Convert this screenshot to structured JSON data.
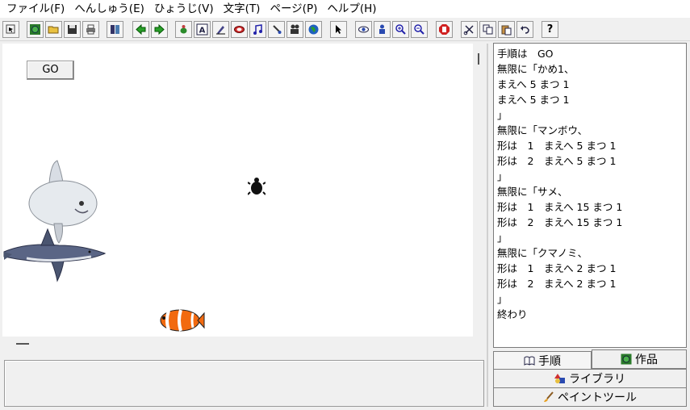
{
  "menu": [
    "ファイル(F)",
    "へんしゅう(E)",
    "ひょうじ(V)",
    "文字(T)",
    "ページ(P)",
    "ヘルプ(H)"
  ],
  "toolbar_icons": [
    "pointer-icon",
    "globe-icon",
    "open-folder-icon",
    "save-icon",
    "print-icon",
    "page-layout-icon",
    "arrow-left-icon",
    "arrow-right-icon",
    "turtle-icon",
    "text-icon",
    "pen-icon",
    "stamp-icon",
    "music-icon",
    "paint-brush-icon",
    "camera-icon",
    "world-icon",
    "select-arrow-icon",
    "eye-icon",
    "person-icon",
    "zoom-in-icon",
    "zoom-out-icon",
    "stop-icon",
    "cut-icon",
    "copy-icon",
    "paste-icon",
    "undo-icon",
    "help-icon"
  ],
  "stage": {
    "go_label": "GO"
  },
  "code": [
    "手順は　GO",
    "無限に「かめ1、",
    "まえへ 5 まつ 1",
    "まえへ 5 まつ 1",
    "」",
    "無限に「マンボウ、",
    "形は　1　まえへ 5 まつ 1",
    "形は　2　まえへ 5 まつ 1",
    "」",
    "無限に「サメ、",
    "形は　1　まえへ 15 まつ 1",
    "形は　2　まえへ 15 まつ 1",
    "」",
    "無限に「クマノミ、",
    "形は　1　まえへ 2 まつ 1",
    "形は　2　まえへ 2 まつ 1",
    "」",
    "終わり"
  ],
  "tabs": {
    "procedure": "手順",
    "works": "作品",
    "library": "ライブラリ",
    "paint_tool": "ペイントツール"
  },
  "colors": {
    "canvas_bg": "#ffffff",
    "window_bg": "#f0f0f0",
    "clownfish": "#f26a10",
    "shark": "#4a5570"
  }
}
